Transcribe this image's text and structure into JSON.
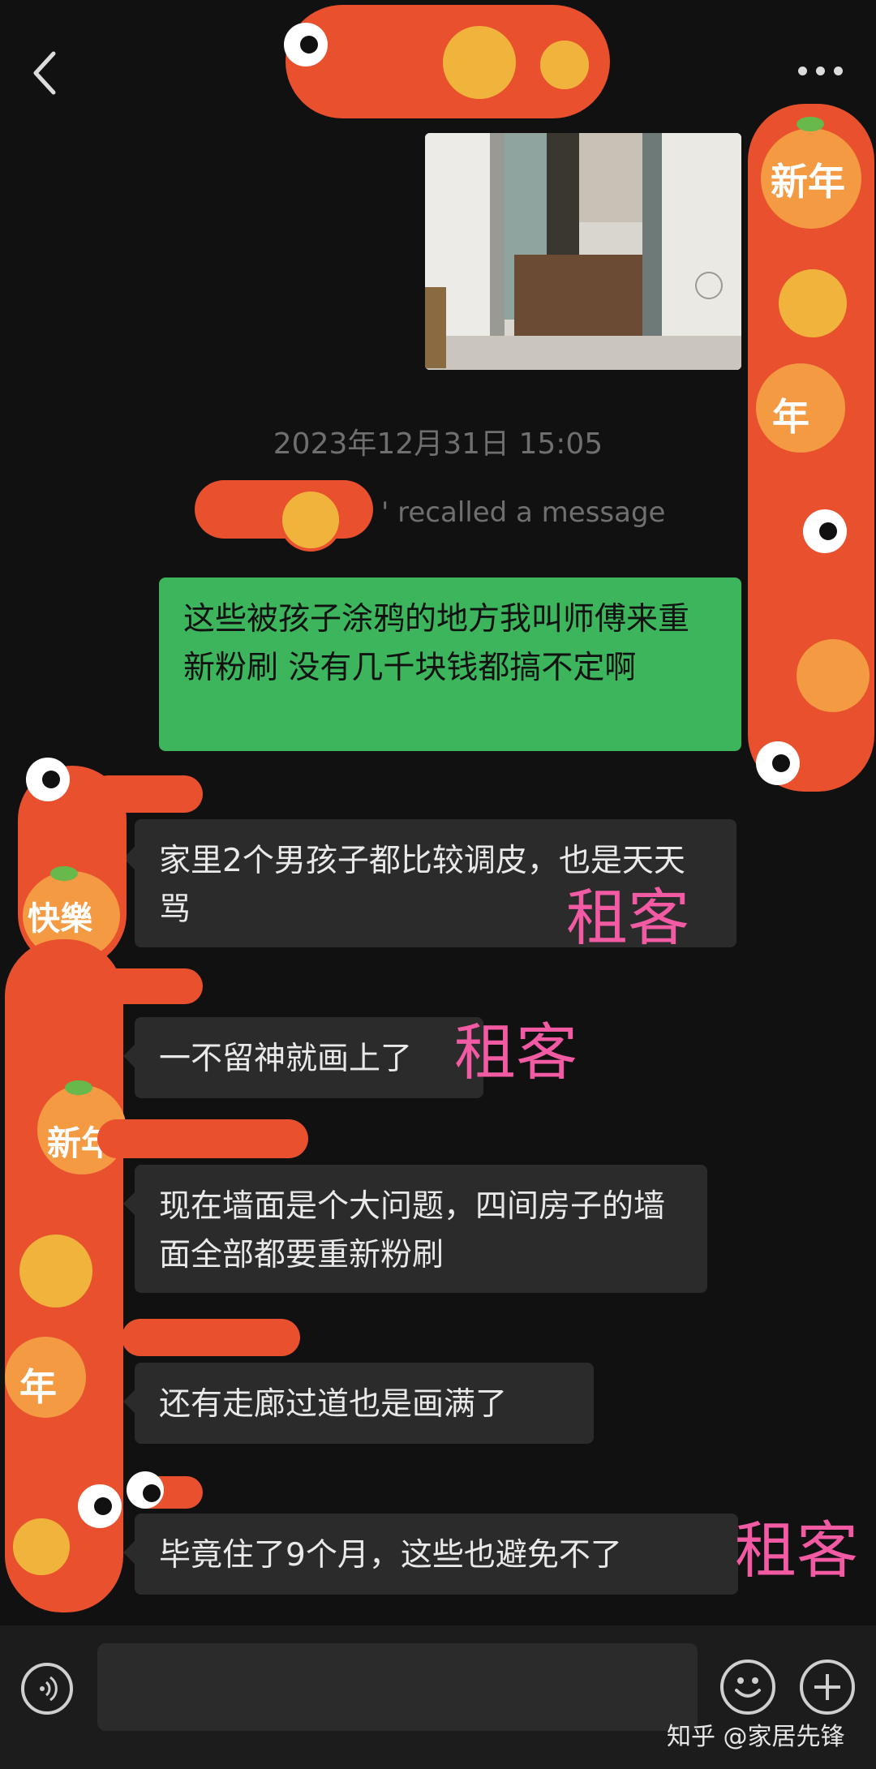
{
  "header": {
    "back_icon": "chevron-left-icon",
    "more_icon": "more-dots-icon"
  },
  "timestamp": "2023年12月31日 15:05",
  "recalled_text": "' recalled a message",
  "messages": [
    {
      "side": "me",
      "text": "这些被孩子涂鸦的地方我叫师傅来重新粉刷 没有几千块钱都搞不定啊"
    },
    {
      "side": "other",
      "text": "家里2个男孩子都比较调皮，也是天天骂"
    },
    {
      "side": "other",
      "text": "一不留神就画上了"
    },
    {
      "side": "other",
      "text": "现在墙面是个大问题，四间房子的墙面全部都要重新粉刷"
    },
    {
      "side": "other",
      "text": "还有走廊过道也是画满了"
    },
    {
      "side": "other",
      "text": "毕竟住了9个月，这些也避免不了"
    }
  ],
  "annotations": {
    "tenant_1": "租客",
    "tenant_2": "租客",
    "tenant_3": "租客"
  },
  "doodle_text": {
    "a": "新年",
    "b": "新年",
    "c": "年",
    "d": "快樂",
    "e": "年"
  },
  "bottom": {
    "voice_icon": "voice-icon",
    "emoji_icon": "emoji-icon",
    "plus_icon": "plus-icon"
  },
  "watermark": "知乎 @家居先锋",
  "colors": {
    "background": "#111111",
    "my_bubble": "#3cb55c",
    "other_bubble": "#2b2b2b",
    "annotation": "#f25aa3",
    "doodle": "#e8502e"
  }
}
